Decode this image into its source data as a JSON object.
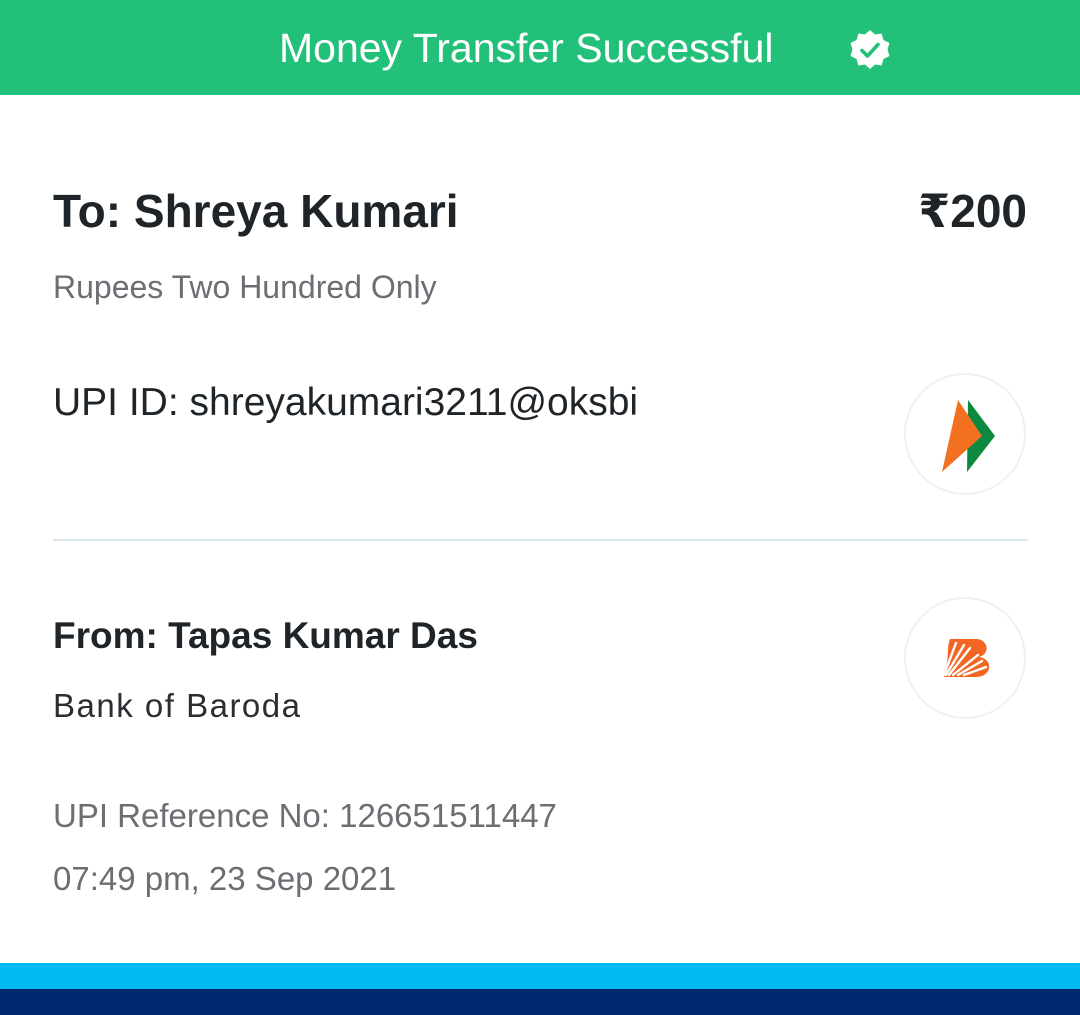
{
  "header": {
    "title": "Money Transfer Successful",
    "icon": "verified-check-icon",
    "background": "#23c07a"
  },
  "recipient": {
    "to_label": "To: Shreya Kumari",
    "amount": "₹200",
    "amount_words": "Rupees Two Hundred Only",
    "upi_id": "UPI ID: shreyakumari3211@oksbi",
    "logo_icon": "upi-logo-icon"
  },
  "sender": {
    "from_label": "From: Tapas Kumar Das",
    "bank": "Bank of Baroda",
    "logo_icon": "bank-of-baroda-logo-icon"
  },
  "transaction": {
    "reference": "UPI Reference No: 126651511447",
    "timestamp": "07:49 pm, 23 Sep 2021"
  },
  "colors": {
    "brand_light": "#00baf2",
    "brand_dark": "#002970",
    "upi_orange": "#f37021",
    "upi_green": "#0b8a3f",
    "bob_orange": "#f26522"
  }
}
